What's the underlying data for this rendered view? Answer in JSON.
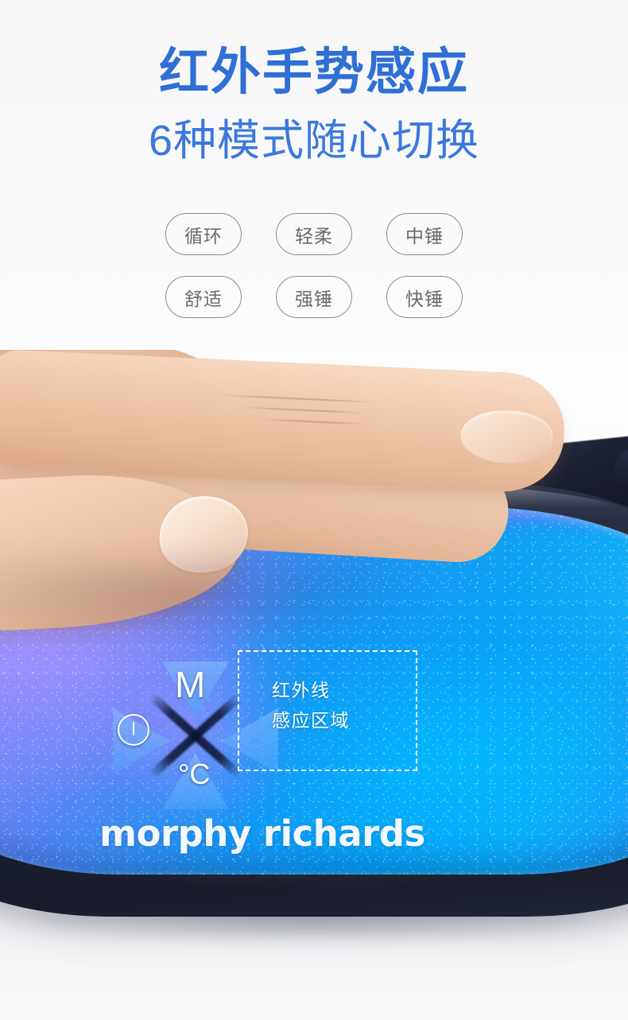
{
  "headline": "红外手势感应",
  "subheadline": "6种模式随心切换",
  "modes": {
    "row1": [
      {
        "label": "循环"
      },
      {
        "label": "轻柔"
      },
      {
        "label": "中锤"
      }
    ],
    "row2": [
      {
        "label": "舒适"
      },
      {
        "label": "强锤"
      },
      {
        "label": "快锤"
      }
    ]
  },
  "device": {
    "controls": {
      "mode_glyph": "M",
      "temperature_glyph": "°C",
      "power_icon": "power-icon"
    },
    "infrared_callout": {
      "line1": "红外线",
      "line2": "感应区域"
    },
    "brand": "morphy richards"
  },
  "colors": {
    "headline_blue": "#2f6fd6",
    "subheadline_blue": "#3a78de",
    "pill_border": "#8d8d8d",
    "pill_text": "#6b6b6b",
    "page_background": "#f8f8f9",
    "device_shell": "#1e2333",
    "plate_cyan": "#0ba3f3",
    "plate_violet": "#9c8dfa",
    "callout_white": "#ffffff"
  }
}
